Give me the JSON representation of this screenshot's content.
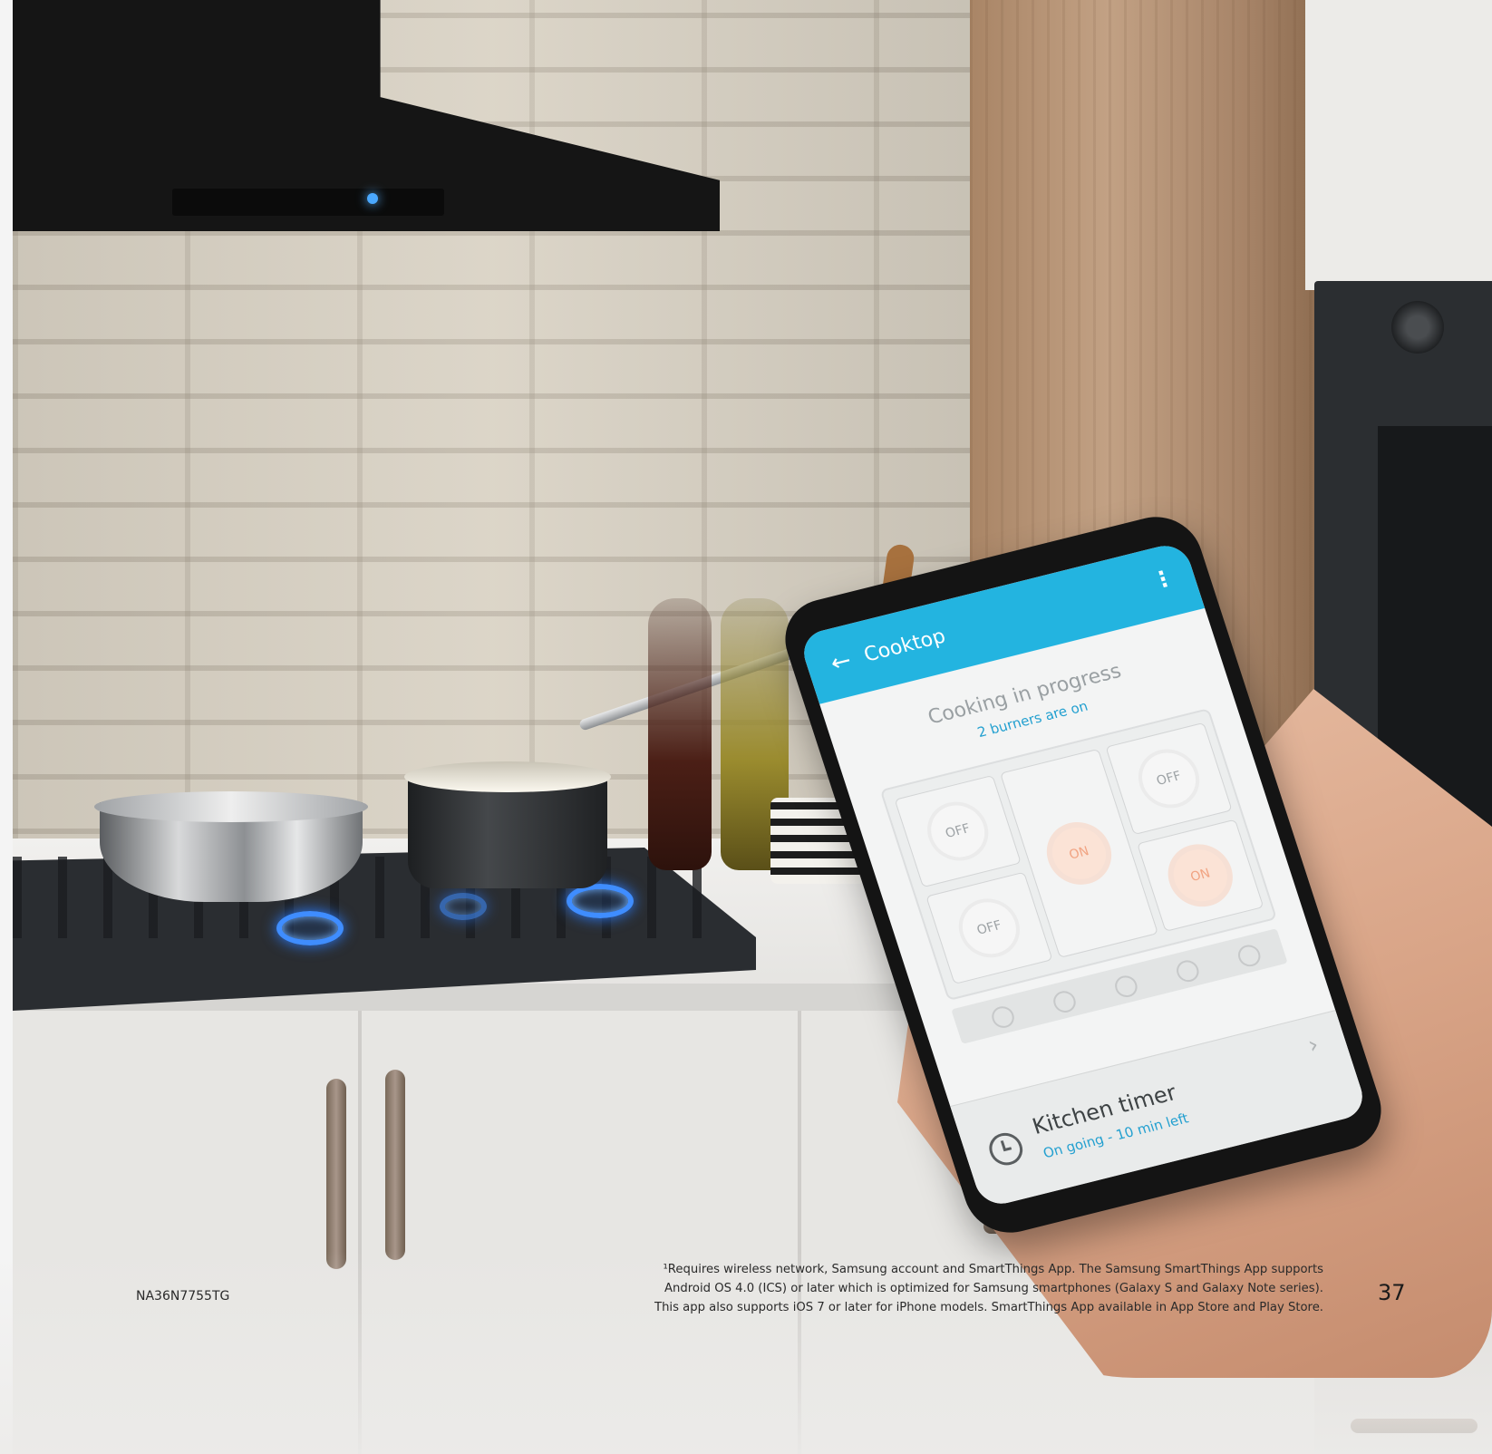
{
  "phone_app": {
    "title": "Cooktop",
    "status_title": "Cooking in progress",
    "status_subtitle": "2 burners are on",
    "burners": [
      {
        "label": "OFF",
        "state": "off"
      },
      {
        "label": "OFF",
        "state": "off"
      },
      {
        "label": "ON",
        "state": "on"
      },
      {
        "label": "OFF",
        "state": "off"
      },
      {
        "label": "ON",
        "state": "on"
      }
    ],
    "timer_title": "Kitchen timer",
    "timer_subtitle": "On going - 10 min left"
  },
  "icons": {
    "back": "←",
    "more": "⋮",
    "chevron": "›"
  },
  "page": {
    "model": "NA36N7755TG",
    "footnote_lines": [
      "¹Requires wireless network, Samsung account and SmartThings App. The Samsung SmartThings App supports",
      "Android OS 4.0 (ICS) or later which is optimized for Samsung smartphones (Galaxy S and Galaxy Note series).",
      "This app also supports iOS 7 or later for iPhone models. SmartThings App available in App Store and Play Store."
    ],
    "page_number": "37"
  },
  "colors": {
    "app_accent": "#23b4e0",
    "burner_on": "#f1a483",
    "flame": "#3f8dff"
  }
}
